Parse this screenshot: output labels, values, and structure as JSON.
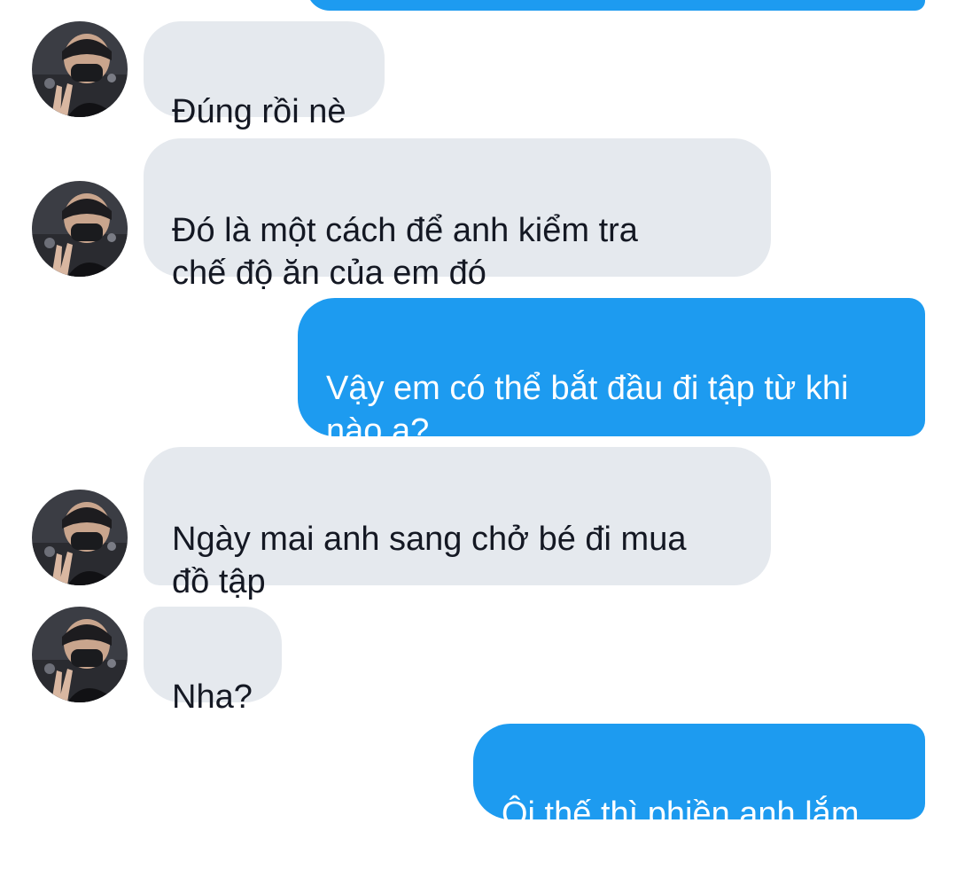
{
  "conversation": {
    "messages": [
      {
        "sender": "them",
        "text": "Đúng rồi nè"
      },
      {
        "sender": "them",
        "text": "Đó là một cách để anh kiểm tra\nchế độ ăn của em đó"
      },
      {
        "sender": "me",
        "text": "Vậy em có thể bắt đầu đi tập từ khi\nnào ạ?"
      },
      {
        "sender": "them",
        "text": "Ngày mai anh sang chở bé đi mua\nđồ tập"
      },
      {
        "sender": "them",
        "text": "Nha?"
      },
      {
        "sender": "me",
        "text": "Ôi thế thì phiền anh lắm"
      }
    ]
  },
  "colors": {
    "incoming_bubble": "#e5e9ee",
    "outgoing_bubble": "#1d9bf0",
    "background": "#ffffff"
  },
  "icons": {
    "avatar": "contact-avatar-photo"
  }
}
